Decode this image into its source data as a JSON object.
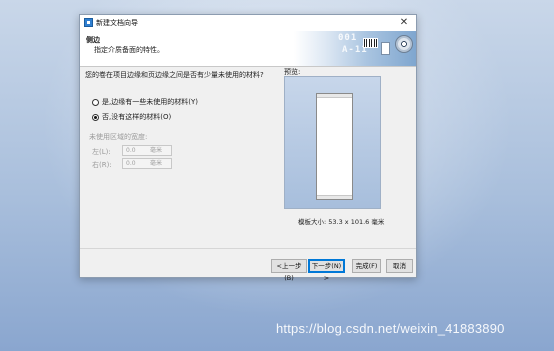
{
  "window": {
    "title": "新建文档向导",
    "close_glyph": "✕"
  },
  "header": {
    "title": "侧边",
    "subtitle": "指定介质备面的特性。",
    "banner_text_1": "001",
    "banner_text_2": "A-11"
  },
  "main": {
    "question": "您的卷在项目边缘和页边缘之间是否有少量未使用的材料?",
    "radio_yes": "是,边缘有一些未使用的材料(Y)",
    "radio_no": "否,没有这样的材料(O)",
    "selected_option": "no",
    "unused_width_label": "未使用区域的宽度:",
    "left_label": "左(L):",
    "left_value": "0.0",
    "right_label": "右(R):",
    "right_value": "0.0",
    "unit": "毫米"
  },
  "preview": {
    "label": "预览:",
    "template_size": "模板大小: 53.3 x 101.6 毫米"
  },
  "buttons": {
    "back": "<上一步(B)",
    "next": "下一步(N) >",
    "finish": "完成(F)",
    "cancel": "取消"
  },
  "watermark": "https://blog.csdn.net/weixin_41883890",
  "colors": {
    "desktop": "#a9bfdc",
    "dialog": "#f0f0f0",
    "default_button_border": "#0078d7"
  }
}
